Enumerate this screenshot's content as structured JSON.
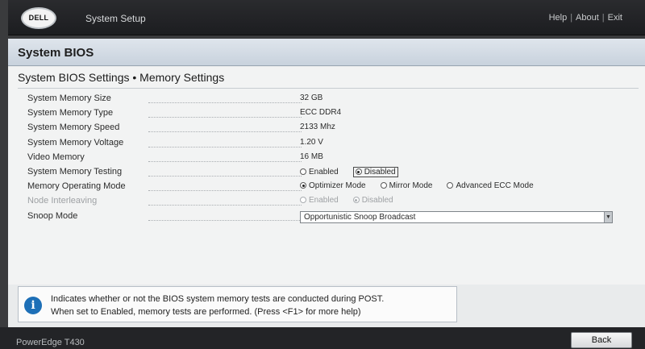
{
  "header": {
    "logo_text": "DELL",
    "app_title": "System Setup",
    "links": [
      "Help",
      "About",
      "Exit"
    ]
  },
  "panel_title": "System BIOS",
  "section_title": "System BIOS Settings • Memory Settings",
  "settings": {
    "memory_size": {
      "label": "System Memory Size",
      "value": "32 GB"
    },
    "memory_type": {
      "label": "System Memory Type",
      "value": "ECC DDR4"
    },
    "memory_speed": {
      "label": "System Memory Speed",
      "value": "2133 Mhz"
    },
    "memory_voltage": {
      "label": "System Memory Voltage",
      "value": "1.20 V"
    },
    "video_memory": {
      "label": "Video Memory",
      "value": "16 MB"
    },
    "memory_testing": {
      "label": "System Memory Testing",
      "options": [
        "Enabled",
        "Disabled"
      ],
      "selected": "Disabled"
    },
    "operating_mode": {
      "label": "Memory Operating Mode",
      "options": [
        "Optimizer Mode",
        "Mirror Mode",
        "Advanced ECC Mode"
      ],
      "selected": "Optimizer Mode"
    },
    "node_interleaving": {
      "label": "Node Interleaving",
      "options": [
        "Enabled",
        "Disabled"
      ],
      "selected": "Disabled",
      "disabled": true
    },
    "snoop_mode": {
      "label": "Snoop Mode",
      "value": "Opportunistic Snoop Broadcast"
    }
  },
  "help": {
    "line1": "Indicates whether or not the BIOS system memory tests are conducted during POST.",
    "line2": "When set to Enabled, memory tests are performed. (Press <F1> for more help)",
    "icon": "info-icon"
  },
  "footer": {
    "model": "PowerEdge T430",
    "back_label": "Back"
  }
}
